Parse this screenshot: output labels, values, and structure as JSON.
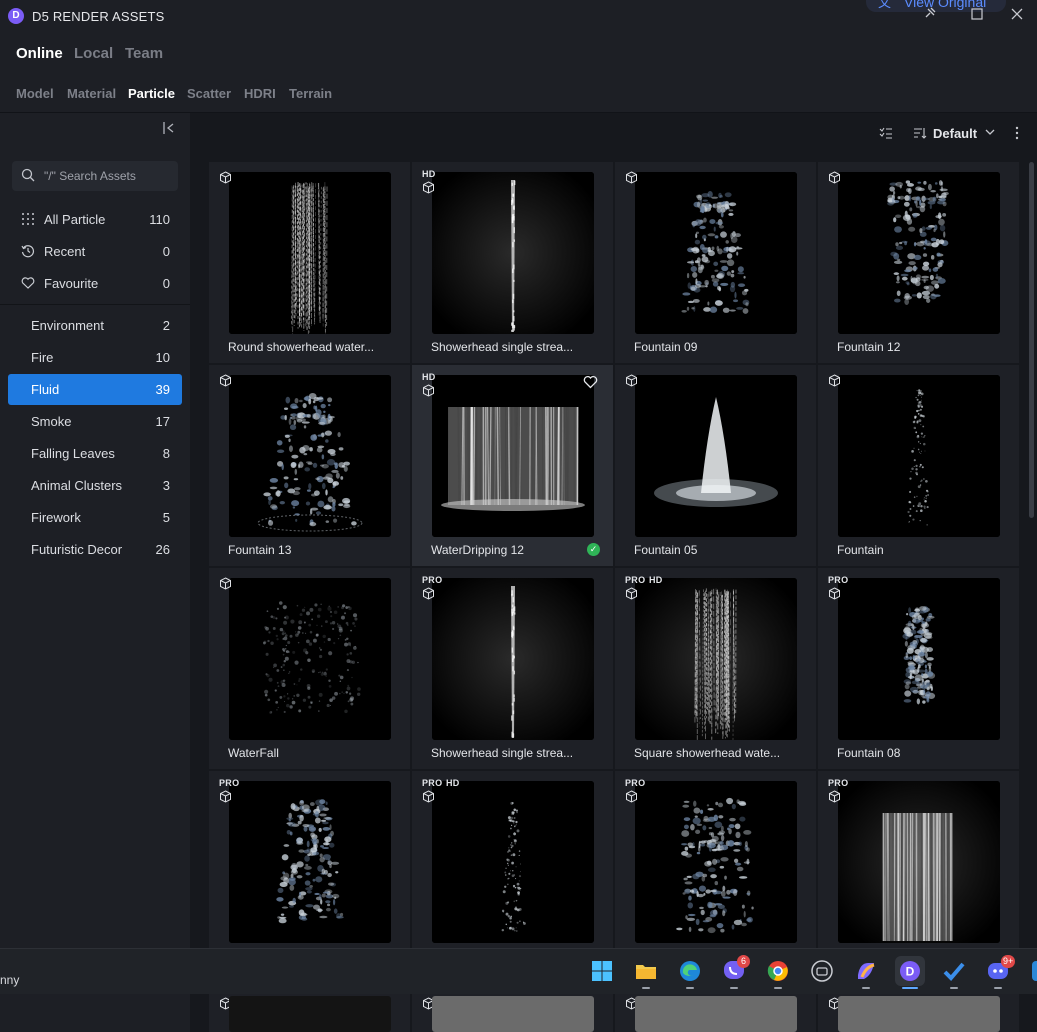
{
  "app": {
    "title": "D5 RENDER ASSETS",
    "logo_letter": "D",
    "view_original": "View Original"
  },
  "modes": [
    {
      "label": "Online",
      "active": true
    },
    {
      "label": "Local",
      "active": false
    },
    {
      "label": "Team",
      "active": false
    }
  ],
  "categories": [
    {
      "label": "Model",
      "active": false
    },
    {
      "label": "Material",
      "active": false
    },
    {
      "label": "Particle",
      "active": true
    },
    {
      "label": "Scatter",
      "active": false
    },
    {
      "label": "HDRI",
      "active": false
    },
    {
      "label": "Terrain",
      "active": false
    }
  ],
  "search": {
    "placeholder": "\"/\" Search Assets"
  },
  "sidebar_top": [
    {
      "label": "All Particle",
      "count": "110",
      "icon": "grid-icon"
    },
    {
      "label": "Recent",
      "count": "0",
      "icon": "history-icon"
    },
    {
      "label": "Favourite",
      "count": "0",
      "icon": "heart-icon"
    }
  ],
  "sidebar_cats": [
    {
      "label": "Environment",
      "count": "2",
      "active": false
    },
    {
      "label": "Fire",
      "count": "10",
      "active": false
    },
    {
      "label": "Fluid",
      "count": "39",
      "active": true
    },
    {
      "label": "Smoke",
      "count": "17",
      "active": false
    },
    {
      "label": "Falling Leaves",
      "count": "8",
      "active": false
    },
    {
      "label": "Animal Clusters",
      "count": "3",
      "active": false
    },
    {
      "label": "Firework",
      "count": "5",
      "active": false
    },
    {
      "label": "Futuristic Decor",
      "count": "26",
      "active": false
    }
  ],
  "toolbar": {
    "sort_label": "Default"
  },
  "assets": [
    {
      "name": "Round showerhead water...",
      "pro": false,
      "hd": false,
      "art": "shower-round"
    },
    {
      "name": "Showerhead single strea...",
      "pro": false,
      "hd": true,
      "art": "single-stream"
    },
    {
      "name": "Fountain 09",
      "pro": false,
      "hd": false,
      "art": "splash-column"
    },
    {
      "name": "Fountain 12",
      "pro": false,
      "hd": false,
      "art": "splash-burst"
    },
    {
      "name": "Fountain 13",
      "pro": false,
      "hd": false,
      "art": "fountain-ring"
    },
    {
      "name": "WaterDripping 12",
      "pro": false,
      "hd": true,
      "art": "waterfall-wall",
      "hover": true,
      "downloaded": true
    },
    {
      "name": "Fountain 05",
      "pro": false,
      "hd": false,
      "art": "geyser"
    },
    {
      "name": "Fountain",
      "pro": false,
      "hd": false,
      "art": "thin-spray"
    },
    {
      "name": "WaterFall",
      "pro": false,
      "hd": false,
      "art": "mist-sheet"
    },
    {
      "name": "Showerhead single strea...",
      "pro": true,
      "hd": false,
      "art": "single-stream"
    },
    {
      "name": "Square showerhead wate...",
      "pro": true,
      "hd": true,
      "art": "shower-square"
    },
    {
      "name": "Fountain 08",
      "pro": true,
      "hd": false,
      "art": "splash-small"
    },
    {
      "name": "",
      "pro": true,
      "hd": false,
      "art": "splash-column"
    },
    {
      "name": "",
      "pro": true,
      "hd": true,
      "art": "thin-spray"
    },
    {
      "name": "",
      "pro": true,
      "hd": false,
      "art": "splash-rock"
    },
    {
      "name": "",
      "pro": true,
      "hd": false,
      "art": "curtain"
    }
  ],
  "taskbar": {
    "user_text": "nny",
    "apps": [
      {
        "name": "windows-start",
        "badge": ""
      },
      {
        "name": "file-explorer",
        "badge": ""
      },
      {
        "name": "edge",
        "badge": ""
      },
      {
        "name": "viber",
        "badge": "6"
      },
      {
        "name": "chrome",
        "badge": ""
      },
      {
        "name": "capture",
        "badge": ""
      },
      {
        "name": "copilot",
        "badge": ""
      },
      {
        "name": "d5-render",
        "badge": "",
        "active": true
      },
      {
        "name": "todo",
        "badge": ""
      },
      {
        "name": "discord",
        "badge": "9+"
      }
    ]
  }
}
